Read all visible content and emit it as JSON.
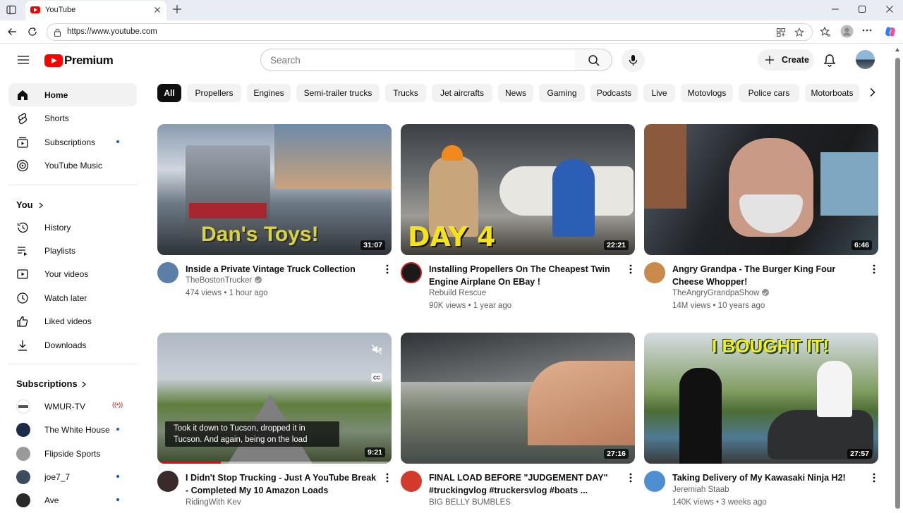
{
  "browser": {
    "tab_title": "YouTube",
    "url": "https://www.youtube.com"
  },
  "header": {
    "logo_text": "Premium",
    "search_placeholder": "Search",
    "create_label": "Create"
  },
  "sidebar": {
    "main": [
      {
        "label": "Home",
        "icon": "home-icon",
        "active": true
      },
      {
        "label": "Shorts",
        "icon": "shorts-icon"
      },
      {
        "label": "Subscriptions",
        "icon": "subscriptions-icon",
        "dot": true
      },
      {
        "label": "YouTube Music",
        "icon": "youtube-music-icon"
      }
    ],
    "you_heading": "You",
    "you": [
      {
        "label": "History",
        "icon": "history-icon"
      },
      {
        "label": "Playlists",
        "icon": "playlists-icon"
      },
      {
        "label": "Your videos",
        "icon": "your-videos-icon"
      },
      {
        "label": "Watch later",
        "icon": "watch-later-icon"
      },
      {
        "label": "Liked videos",
        "icon": "liked-videos-icon"
      },
      {
        "label": "Downloads",
        "icon": "download-icon"
      }
    ],
    "subscriptions_heading": "Subscriptions",
    "subscriptions": [
      {
        "label": "WMUR-TV",
        "indicator": "live",
        "color": "#ffffff"
      },
      {
        "label": "The White House",
        "indicator": "dot",
        "color": "#1c2b4a"
      },
      {
        "label": "Flipside Sports",
        "indicator": "none",
        "color": "#9a9a9a"
      },
      {
        "label": "joe7_7",
        "indicator": "dot",
        "color": "#3a4d5c"
      },
      {
        "label": "Ave",
        "indicator": "dot",
        "color": "#2a2a2a"
      }
    ]
  },
  "chips": [
    "All",
    "Propellers",
    "Engines",
    "Semi-trailer trucks",
    "Trucks",
    "Jet aircrafts",
    "News",
    "Gaming",
    "Podcasts",
    "Live",
    "Motovlogs",
    "Police cars",
    "Motorboats"
  ],
  "videos": [
    {
      "title": "Inside a Private Vintage Truck Collection",
      "channel": "TheBostonTrucker",
      "verified": true,
      "views": "474 views",
      "age": "1 hour ago",
      "duration": "31:07",
      "overlay": "Dan's Toys!",
      "avatar_color": "#5b7fa6"
    },
    {
      "title": "Installing Propellers On The Cheapest Twin Engine Airplane On EBay !",
      "channel": "Rebuild Rescue",
      "verified": false,
      "views": "90K views",
      "age": "1 year ago",
      "duration": "22:21",
      "overlay": "DAY 4",
      "avatar_color": "#1a1a1a"
    },
    {
      "title": "Angry Grandpa - The Burger King Four Cheese Whopper!",
      "channel": "TheAngryGrandpaShow",
      "verified": true,
      "views": "14M views",
      "age": "10 years ago",
      "duration": "6:46",
      "overlay": "",
      "avatar_color": "#c98a4a"
    },
    {
      "title": "I Didn't Stop Trucking - Just A YouTube Break - Completed My 10 Amazon Loads",
      "channel": "RidingWith Kev",
      "verified": false,
      "views": "",
      "age": "",
      "duration": "9:21",
      "overlay": "",
      "caption": "Took it down to Tucson, dropped it in Tucson. And again, being on the load",
      "progress": 0.27,
      "avatar_color": "#3b2a2a"
    },
    {
      "title": "FINAL LOAD BEFORE \"JUDGEMENT DAY\" #truckingvlog #truckersvlog #boats ...",
      "channel": "BIG BELLY BUMBLES",
      "verified": false,
      "views": "",
      "age": "",
      "duration": "27:16",
      "overlay": "",
      "avatar_color": "#d23b2b"
    },
    {
      "title": "Taking Delivery of My Kawasaki Ninja H2!",
      "channel": "Jeremiah Staab",
      "verified": false,
      "views": "140K views",
      "age": "3 weeks ago",
      "duration": "27:57",
      "overlay": "I BOUGHT IT!",
      "avatar_color": "#4d8fd1"
    }
  ],
  "colors": {
    "brand": "#ff0000",
    "chip_bg": "#f2f2f2",
    "active_chip": "#0f0f0f",
    "link_dot": "#065fd4"
  }
}
